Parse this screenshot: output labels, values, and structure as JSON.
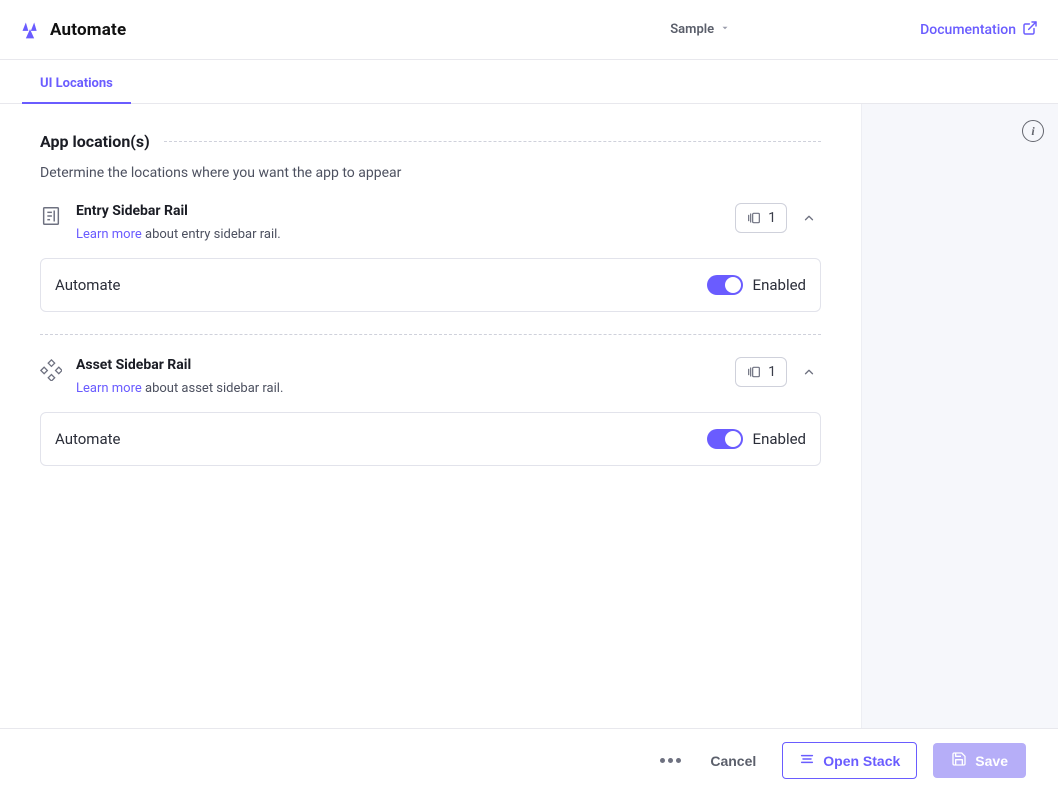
{
  "header": {
    "app_title": "Automate",
    "sample_label": "Sample",
    "doc_link_label": "Documentation"
  },
  "tabs": {
    "ui_locations": "UI Locations"
  },
  "section": {
    "title": "App location(s)",
    "subtitle": "Determine the locations where you want the app to appear"
  },
  "locations": [
    {
      "icon": "document-sidebar-icon",
      "title": "Entry Sidebar Rail",
      "learn_more": "Learn more",
      "learn_more_tail": " about entry sidebar rail.",
      "count": "1",
      "toggle_label": "Automate",
      "toggle_state": "Enabled"
    },
    {
      "icon": "diamond-grid-icon",
      "title": "Asset Sidebar Rail",
      "learn_more": "Learn more",
      "learn_more_tail": " about asset sidebar rail.",
      "count": "1",
      "toggle_label": "Automate",
      "toggle_state": "Enabled"
    }
  ],
  "footer": {
    "cancel": "Cancel",
    "open_stack": "Open Stack",
    "save": "Save"
  }
}
